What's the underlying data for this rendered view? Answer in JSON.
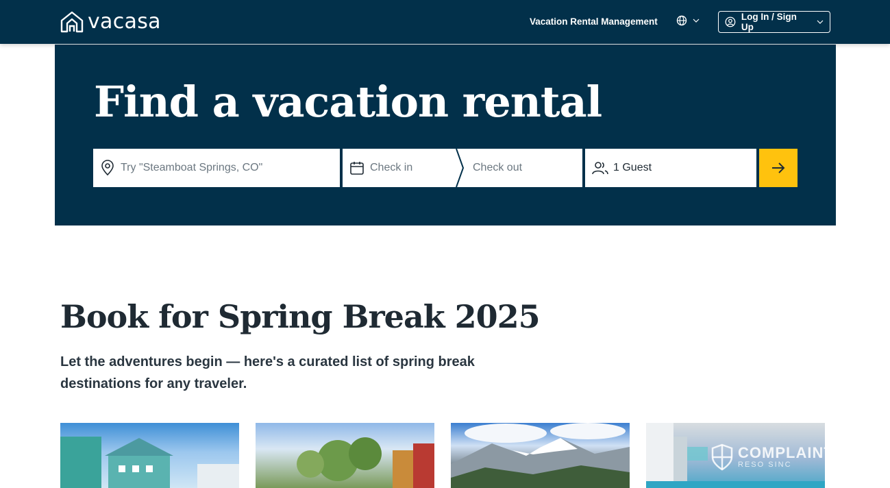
{
  "header": {
    "logo_text": "vacasa",
    "nav_link": "Vacation Rental Management",
    "language_icon": "globe-icon",
    "login_label": "Log In / Sign Up"
  },
  "hero": {
    "title": "Find a vacation rental",
    "search": {
      "destination_placeholder": "Try \"Steamboat Springs, CO\"",
      "check_in_placeholder": "Check in",
      "check_out_placeholder": "Check out",
      "guests_value": "1 Guest",
      "submit_icon": "arrow-right-icon"
    }
  },
  "section": {
    "title": "Book for Spring Break 2025",
    "subtitle": "Let the adventures begin — here's a curated list of spring break destinations for any traveler."
  },
  "cards": [
    {
      "image": "beach-houses-photo"
    },
    {
      "image": "mountain-lodge-trees-photo"
    },
    {
      "image": "snowy-mountains-valley-photo"
    },
    {
      "image": "oceanfront-balcony-photo",
      "watermark": "COMPLAINTBOARD",
      "watermark_small": "RESO SINC"
    }
  ],
  "colors": {
    "navy": "#02304a",
    "accent_yellow": "#ffc20e",
    "white": "#ffffff"
  }
}
